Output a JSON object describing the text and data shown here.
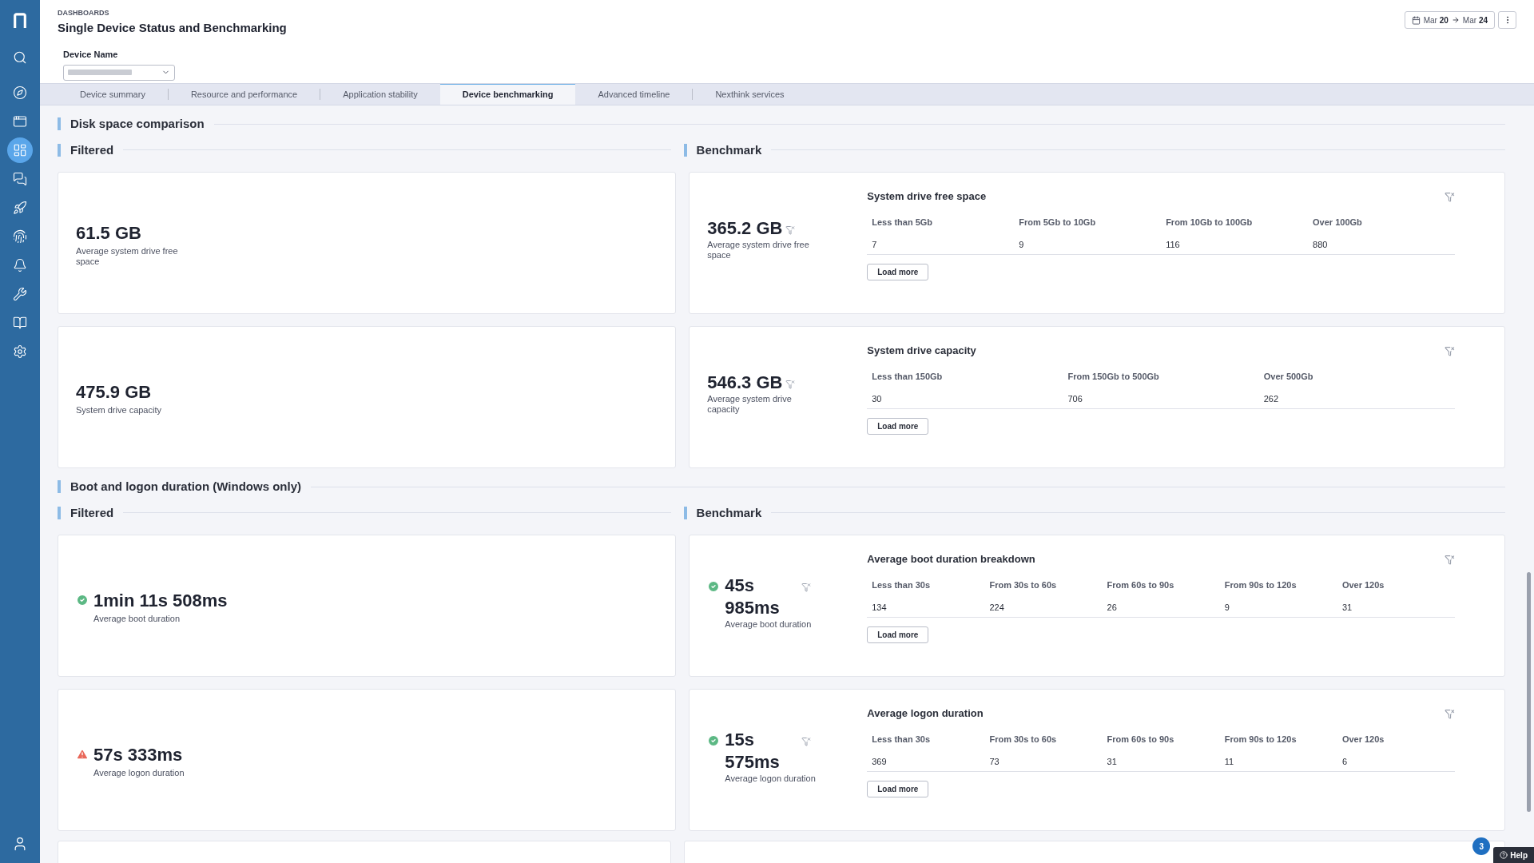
{
  "sidebar": {
    "items": [
      {
        "selected": false
      },
      {
        "selected": false
      },
      {
        "selected": false
      },
      {
        "selected": true
      },
      {
        "selected": false
      },
      {
        "selected": false
      },
      {
        "selected": false
      },
      {
        "selected": false
      },
      {
        "selected": false
      },
      {
        "selected": false
      },
      {
        "selected": false
      }
    ]
  },
  "header": {
    "breadcrumb": "DASHBOARDS",
    "title": "Single Device Status and Benchmarking",
    "date_from_label": "Mar",
    "date_from_day": "20",
    "date_to_label": "Mar",
    "date_to_day": "24"
  },
  "device_filter": {
    "label": "Device Name"
  },
  "tabs": [
    {
      "label": "Device summary",
      "selected": false
    },
    {
      "label": "Resource and performance",
      "selected": false
    },
    {
      "label": "Application stability",
      "selected": false
    },
    {
      "label": "Device benchmarking",
      "selected": true
    },
    {
      "label": "Advanced timeline",
      "selected": false
    },
    {
      "label": "Nexthink services",
      "selected": false
    }
  ],
  "sections": [
    {
      "title": "Disk space comparison",
      "filtered_label": "Filtered",
      "benchmark_label": "Benchmark",
      "rows": [
        {
          "filtered": {
            "kind": "plain",
            "value": "61.5 GB",
            "caption": "Average system drive free space"
          },
          "benchmark": {
            "kind": "plain",
            "value": "365.2 GB",
            "caption": "Average system drive free space",
            "title": "System drive free space",
            "columns": [
              "Less than 5Gb",
              "From 5Gb to 10Gb",
              "From 10Gb to 100Gb",
              "Over 100Gb"
            ],
            "counts": [
              "7",
              "9",
              "116",
              "880"
            ],
            "button": "Load more"
          }
        },
        {
          "filtered": {
            "kind": "plain",
            "value": "475.9 GB",
            "caption": "System drive capacity"
          },
          "benchmark": {
            "kind": "plain",
            "value": "546.3 GB",
            "caption": "Average system drive capacity",
            "title": "System drive capacity",
            "columns": [
              "Less than 150Gb",
              "From 150Gb to 500Gb",
              "Over 500Gb"
            ],
            "counts": [
              "30",
              "706",
              "262"
            ],
            "button": "Load more"
          }
        }
      ]
    },
    {
      "title": "Boot and logon duration (Windows only)",
      "filtered_label": "Filtered",
      "benchmark_label": "Benchmark",
      "rows": [
        {
          "filtered": {
            "kind": "ok",
            "value": "1min 11s 508ms",
            "caption": "Average boot duration"
          },
          "benchmark": {
            "kind": "ok",
            "value": "45s 985ms",
            "caption": "Average boot duration",
            "title": "Average boot duration breakdown",
            "columns": [
              "Less than 30s",
              "From 30s to 60s",
              "From 60s to 90s",
              "From 90s to 120s",
              "Over 120s"
            ],
            "counts": [
              "134",
              "224",
              "26",
              "9",
              "31"
            ],
            "button": "Load more"
          }
        },
        {
          "filtered": {
            "kind": "warning",
            "value": "57s 333ms",
            "caption": "Average logon duration"
          },
          "benchmark": {
            "kind": "ok",
            "value": "15s 575ms",
            "caption": "Average logon duration",
            "title": "Average logon duration",
            "columns": [
              "Less than 30s",
              "From 30s to 60s",
              "From 60s to 90s",
              "From 90s to 120s",
              "Over 120s"
            ],
            "counts": [
              "369",
              "73",
              "31",
              "11",
              "6"
            ],
            "button": "Load more"
          }
        }
      ]
    }
  ],
  "help": {
    "label": "Help",
    "badge": "3"
  }
}
